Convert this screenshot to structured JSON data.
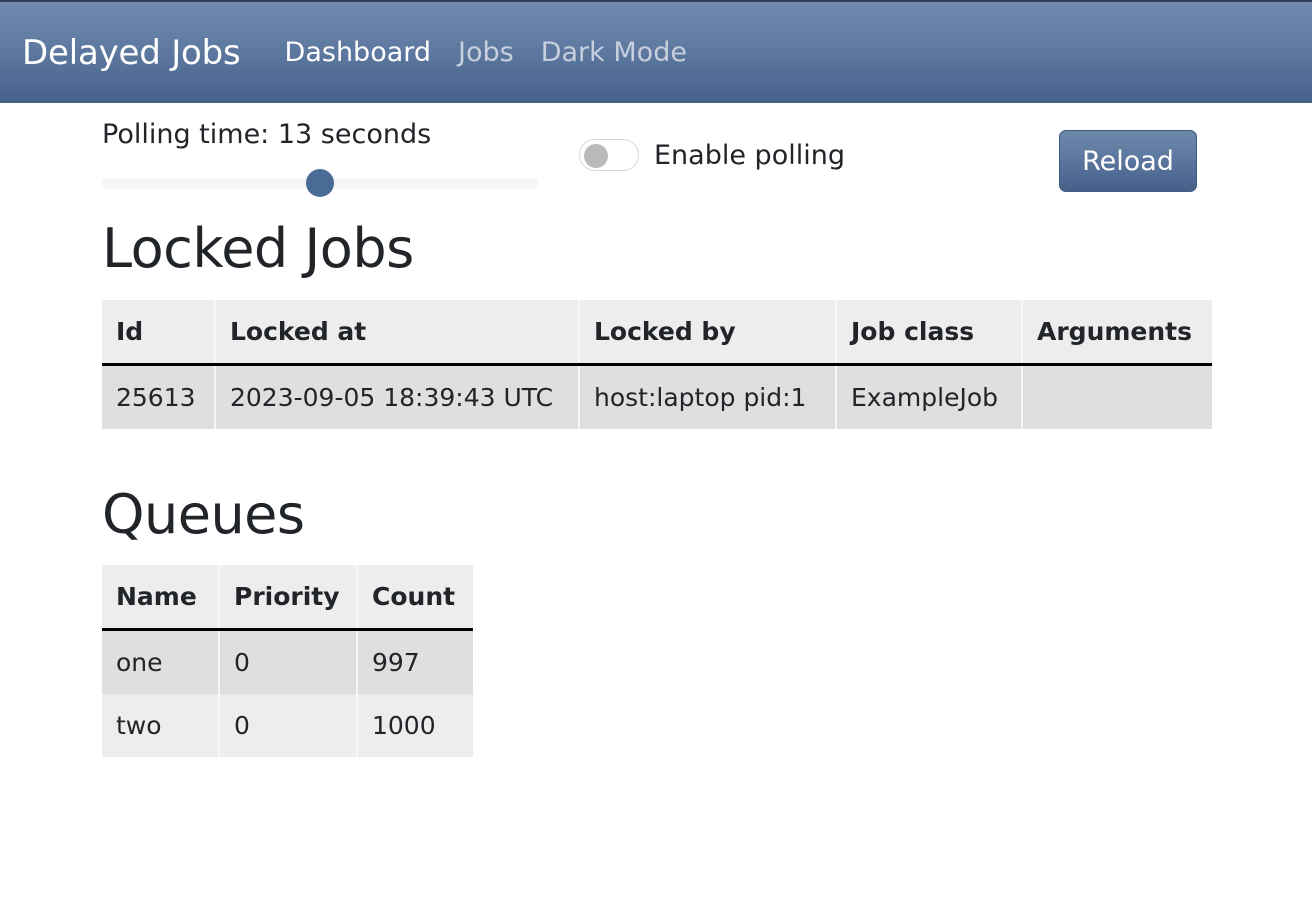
{
  "navbar": {
    "brand": "Delayed Jobs",
    "links": [
      {
        "label": "Dashboard",
        "state": "active"
      },
      {
        "label": "Jobs",
        "state": "muted"
      },
      {
        "label": "Dark Mode",
        "state": "muted"
      }
    ]
  },
  "controls": {
    "polling_label": "Polling time: 13 seconds",
    "polling_seconds": 13,
    "slider": {
      "value": 13,
      "min": 1,
      "max": 30,
      "percent": 47
    },
    "toggle": {
      "label": "Enable polling",
      "checked": false
    },
    "reload_label": "Reload"
  },
  "locked_jobs": {
    "title": "Locked Jobs",
    "columns": [
      "Id",
      "Locked at",
      "Locked by",
      "Job class",
      "Arguments"
    ],
    "rows": [
      {
        "id": "25613",
        "locked_at": "2023-09-05 18:39:43 UTC",
        "locked_by": "host:laptop pid:1",
        "job_class": "ExampleJob",
        "arguments": ""
      }
    ]
  },
  "queues": {
    "title": "Queues",
    "columns": [
      "Name",
      "Priority",
      "Count"
    ],
    "rows": [
      {
        "name": "one",
        "priority": "0",
        "count": "997"
      },
      {
        "name": "two",
        "priority": "0",
        "count": "1000"
      }
    ]
  },
  "colors": {
    "navbar_top": "#7089ad",
    "navbar_bottom": "#46618a",
    "accent_blue": "#4a6b93",
    "table_header_bg": "#ededed",
    "table_row_odd_bg": "#dfdfdf",
    "table_row_even_bg": "#ededed",
    "page_bg": "#ffffff"
  }
}
